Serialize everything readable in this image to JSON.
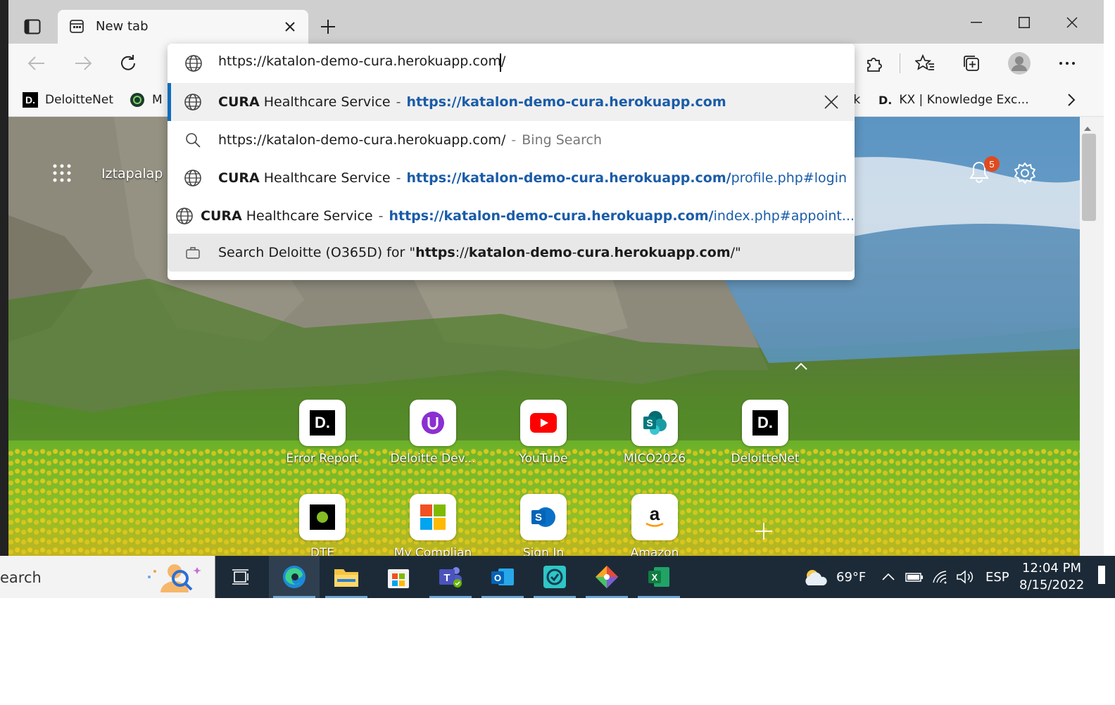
{
  "tab": {
    "title": "New tab"
  },
  "address": {
    "value": "https://katalon-demo-cura.herokuapp.com/"
  },
  "favorites": [
    {
      "label": "DeloitteNet"
    },
    {
      "label": "M"
    },
    {
      "label": "ok"
    },
    {
      "label": "KX | Knowledge Exc..."
    }
  ],
  "suggestions": [
    {
      "bold": "CURA",
      "title": " Healthcare Service",
      "sep": "-",
      "url_bold": "https://katalon-demo-cura.herokuapp.com",
      "url_rest": ""
    },
    {
      "text": "https://katalon-demo-cura.herokuapp.com/",
      "sep": "-",
      "grey": "Bing Search"
    },
    {
      "bold": "CURA",
      "title": " Healthcare Service",
      "sep": "-",
      "url_bold": "https://katalon-demo-cura.herokuapp.com/",
      "url_rest": "profile.php#login"
    },
    {
      "bold": "CURA",
      "title": " Healthcare Service",
      "sep": "-",
      "url_bold": "https://katalon-demo-cura.herokuapp.com/",
      "url_rest": "index.php#appoint..."
    },
    {
      "prefix": "Search Deloitte (O365D) for \"",
      "bold_a": "https",
      "mid_a": "://",
      "bold_b": "katalon",
      "mid_b": "-",
      "bold_c": "demo",
      "mid_c": "-",
      "bold_d": "cura",
      "mid_d": ".",
      "bold_e": "herokuapp",
      "mid_e": ".",
      "bold_f": "com",
      "suffix": "/\""
    }
  ],
  "newtab": {
    "location": "Iztapalap",
    "notifications": "5"
  },
  "quick_links": [
    {
      "label": "Error Report"
    },
    {
      "label": "Deloitte Dev..."
    },
    {
      "label": "YouTube"
    },
    {
      "label": "MICO2026"
    },
    {
      "label": "DeloitteNet"
    },
    {
      "label": "DTE"
    },
    {
      "label": "My Complian"
    },
    {
      "label": "Sign In"
    },
    {
      "label": "Amazon"
    }
  ],
  "taskbar": {
    "search": "earch",
    "weather": "69°F",
    "language": "ESP",
    "time": "12:04 PM",
    "date": "8/15/2022"
  },
  "colors": {
    "accent": "#0f6cbd",
    "link": "#1a5ca8",
    "badge": "#e04a1f"
  }
}
